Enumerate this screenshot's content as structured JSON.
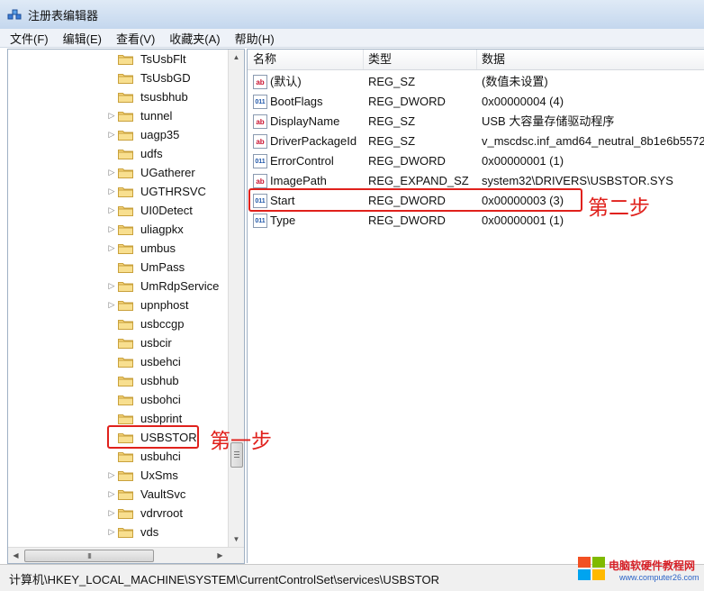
{
  "window": {
    "title": "注册表编辑器"
  },
  "menu": [
    "文件(F)",
    "编辑(E)",
    "查看(V)",
    "收藏夹(A)",
    "帮助(H)"
  ],
  "tree": {
    "items": [
      {
        "label": "TsUsbFlt",
        "expander": false
      },
      {
        "label": "TsUsbGD",
        "expander": false
      },
      {
        "label": "tsusbhub",
        "expander": false
      },
      {
        "label": "tunnel",
        "expander": true
      },
      {
        "label": "uagp35",
        "expander": true
      },
      {
        "label": "udfs",
        "expander": false
      },
      {
        "label": "UGatherer",
        "expander": true
      },
      {
        "label": "UGTHRSVC",
        "expander": true
      },
      {
        "label": "UI0Detect",
        "expander": true
      },
      {
        "label": "uliagpkx",
        "expander": true
      },
      {
        "label": "umbus",
        "expander": true
      },
      {
        "label": "UmPass",
        "expander": false
      },
      {
        "label": "UmRdpService",
        "expander": true
      },
      {
        "label": "upnphost",
        "expander": true
      },
      {
        "label": "usbccgp",
        "expander": false
      },
      {
        "label": "usbcir",
        "expander": false
      },
      {
        "label": "usbehci",
        "expander": false
      },
      {
        "label": "usbhub",
        "expander": false
      },
      {
        "label": "usbohci",
        "expander": false
      },
      {
        "label": "usbprint",
        "expander": false
      },
      {
        "label": "USBSTOR",
        "expander": false
      },
      {
        "label": "usbuhci",
        "expander": false
      },
      {
        "label": "UxSms",
        "expander": true
      },
      {
        "label": "VaultSvc",
        "expander": true
      },
      {
        "label": "vdrvroot",
        "expander": true
      },
      {
        "label": "vds",
        "expander": true
      }
    ],
    "selected": "USBSTOR",
    "hscroll_grip": "III"
  },
  "columns": {
    "name": "名称",
    "type": "类型",
    "data": "数据"
  },
  "values": [
    {
      "icon": "string-value-icon",
      "icon_text": "ab",
      "name": "(默认)",
      "type": "REG_SZ",
      "data": "(数值未设置)"
    },
    {
      "icon": "binary-value-icon",
      "icon_text": "011",
      "name": "BootFlags",
      "type": "REG_DWORD",
      "data": "0x00000004 (4)"
    },
    {
      "icon": "string-value-icon",
      "icon_text": "ab",
      "name": "DisplayName",
      "type": "REG_SZ",
      "data": "USB 大容量存储驱动程序"
    },
    {
      "icon": "string-value-icon",
      "icon_text": "ab",
      "name": "DriverPackageId",
      "type": "REG_SZ",
      "data": "v_mscdsc.inf_amd64_neutral_8b1e6b5572"
    },
    {
      "icon": "binary-value-icon",
      "icon_text": "011",
      "name": "ErrorControl",
      "type": "REG_DWORD",
      "data": "0x00000001 (1)"
    },
    {
      "icon": "string-value-icon",
      "icon_text": "ab",
      "name": "ImagePath",
      "type": "REG_EXPAND_SZ",
      "data": "system32\\DRIVERS\\USBSTOR.SYS"
    },
    {
      "icon": "binary-value-icon",
      "icon_text": "011",
      "name": "Start",
      "type": "REG_DWORD",
      "data": "0x00000003 (3)"
    },
    {
      "icon": "binary-value-icon",
      "icon_text": "011",
      "name": "Type",
      "type": "REG_DWORD",
      "data": "0x00000001 (1)"
    }
  ],
  "status": {
    "path": "计算机\\HKEY_LOCAL_MACHINE\\SYSTEM\\CurrentControlSet\\services\\USBSTOR"
  },
  "annotations": {
    "step1": "第一步",
    "step2": "第二步"
  },
  "watermark": {
    "title": "电脑软硬件教程网",
    "url": "www.computer26.com"
  },
  "colors": {
    "annotation": "#e0211c",
    "watermark_title": "#d61f26",
    "watermark_url": "#2a63c7"
  }
}
